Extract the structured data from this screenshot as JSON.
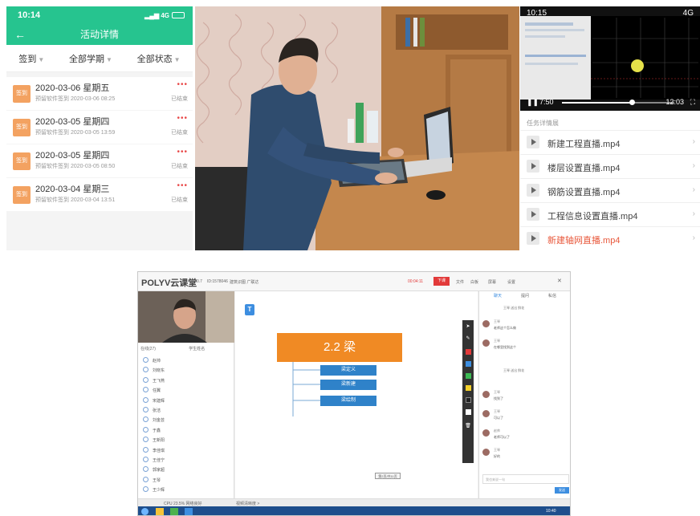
{
  "phone1": {
    "time": "10:14",
    "signal": "4G",
    "title": "活动详情",
    "back_icon": "←",
    "filters": [
      "签到",
      "全部学期",
      "全部状态"
    ],
    "records": [
      {
        "tag": "签到",
        "date": "2020-03-06 星期五",
        "sub": "预留软件签到 2020-03-06 08:25",
        "status": "已结束"
      },
      {
        "tag": "签到",
        "date": "2020-03-05 星期四",
        "sub": "预留软件签到 2020-03-05 13:59",
        "status": "已结束"
      },
      {
        "tag": "签到",
        "date": "2020-03-05 星期四",
        "sub": "预留软件签到 2020-03-05 08:50",
        "status": "已结束"
      },
      {
        "tag": "签到",
        "date": "2020-03-04 星期三",
        "sub": "预留软件签到 2020-03-04 13:51",
        "status": "已结束"
      }
    ],
    "more_icon": "•••"
  },
  "phone2": {
    "time": "10:15",
    "signal": "4G",
    "current_time": "7:50",
    "total_time": "12:03",
    "progress": 0.62,
    "section_title": "任务详情展",
    "videos": [
      {
        "name": "新建工程直播.mp4",
        "active": false
      },
      {
        "name": "楼层设置直播.mp4",
        "active": false
      },
      {
        "name": "钢筋设置直播.mp4",
        "active": false
      },
      {
        "name": "工程信息设置直播.mp4",
        "active": false
      },
      {
        "name": "新建轴网直播.mp4",
        "active": true
      }
    ],
    "active_color": "#e8573a"
  },
  "desktop": {
    "logo": "POLYV云课堂",
    "version": "1.10.7",
    "room": "ID:1578046",
    "course": "建筑识图 广联达",
    "timer": "00:04:11",
    "live_label": "下课",
    "toolbar_items": [
      "文件",
      "白板",
      "屏幕",
      "设置"
    ],
    "online_label": "在线(27)",
    "search_label": "学生姓名",
    "users": [
      "赵帅",
      "刘晓东",
      "王飞燕",
      "任翼",
      "宋建辉",
      "张洁",
      "刘金芸",
      "于鑫",
      "王新阳",
      "李佳琪",
      "王佳宁",
      "郭家超",
      "王琴",
      "王少辉"
    ],
    "slide_title": "2.2 梁",
    "slide_items": [
      "梁定义",
      "梁新建",
      "梁绘制"
    ],
    "page_indicator": "第2页/共11页",
    "chat_tabs": [
      "聊天",
      "提问",
      "私信"
    ],
    "chat_messages": [
      {
        "name": "王琴",
        "text": "老师这个怎么做"
      },
      {
        "name": "王琴",
        "text": "在哪里找到这个"
      },
      {
        "name": "王琴",
        "text": "找到了"
      },
      {
        "name": "王琴",
        "text": "可以了"
      },
      {
        "name": "赵帅",
        "text": "老师可以了"
      },
      {
        "name": "王琴",
        "text": "好的"
      }
    ],
    "system_lines": [
      "王琴 送出 鲜花",
      "王琴 送出 鲜花"
    ],
    "input_placeholder": "我也来说一句",
    "send_label": "发送",
    "status_left": "CPU 23.5% 网络良好",
    "status_mid": "视频清晰度 >",
    "taskbar_time": "10:40"
  },
  "colors": {
    "green": "#26c48f",
    "orange_slide": "#f08a24",
    "blue_chip": "#2f82c9",
    "tag_orange": "#f3a261"
  }
}
